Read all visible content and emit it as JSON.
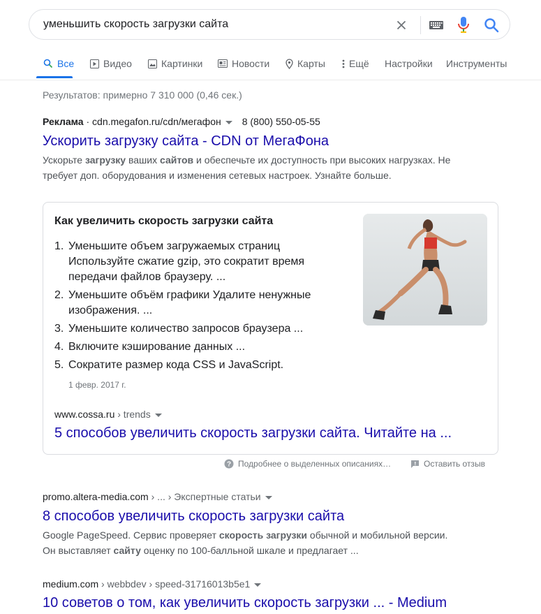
{
  "search": {
    "query": "уменьшить скорость загрузки сайта"
  },
  "tabs": [
    {
      "label": "Все"
    },
    {
      "label": "Видео"
    },
    {
      "label": "Картинки"
    },
    {
      "label": "Новости"
    },
    {
      "label": "Карты"
    },
    {
      "label": "Ещё"
    }
  ],
  "tools": {
    "settings": "Настройки",
    "instruments": "Инструменты"
  },
  "stats": "Результатов: примерно 7 310 000 (0,46 сек.)",
  "ad": {
    "label": "Реклама",
    "separator": " · ",
    "url": "cdn.megafon.ru/cdn/мегафон",
    "phone": "8 (800) 550-05-55",
    "title": "Ускорить загрузку сайта - CDN от МегаФона",
    "snippet_parts": [
      "Ускорьте ",
      "загрузку",
      " ваших ",
      "сайтов",
      " и обеспечьте их доступность при высоких нагрузках. Не требует доп. оборудования и изменения сетевых настроек. Узнайте больше."
    ]
  },
  "featured": {
    "heading": "Как увеличить скорость загрузки сайта",
    "items": [
      {
        "num": "1.",
        "text": "Уменьшите объем загружаемых страниц Используйте сжатие gzip, это сократит время передачи файлов браузеру. ..."
      },
      {
        "num": "2.",
        "text": "Уменьшите объём графики Удалите ненужные изображения. ..."
      },
      {
        "num": "3.",
        "text": "Уменьшите количество запросов браузера ..."
      },
      {
        "num": "4.",
        "text": "Включите кэширование данных ..."
      },
      {
        "num": "5.",
        "text": "Сократите размер кода CSS и JavaScript."
      }
    ],
    "date": "1 февр. 2017 г.",
    "site": "www.cossa.ru",
    "path": " › trends",
    "title": "5 способов увеличить скорость загрузки сайта. Читайте на ..."
  },
  "feedback": {
    "about": "Подробнее о выделенных описаниях…",
    "report": "Оставить отзыв"
  },
  "results": [
    {
      "site": "promo.altera-media.com",
      "path": " › ... › Экспертные статьи",
      "title": "8 способов увеличить скорость загрузки сайта",
      "snippet_parts": [
        "Google PageSpeed. Сервис проверяет ",
        "скорость загрузки",
        " обычной и мобильной версии. Он выставляет ",
        "сайту",
        " оценку по 100-балльной шкале и предлагает ..."
      ]
    },
    {
      "site": "medium.com",
      "path": " › webbdev › speed-31716013b5e1",
      "title": "10 советов о том, как увеличить скорость загрузки ... - Medium"
    }
  ]
}
